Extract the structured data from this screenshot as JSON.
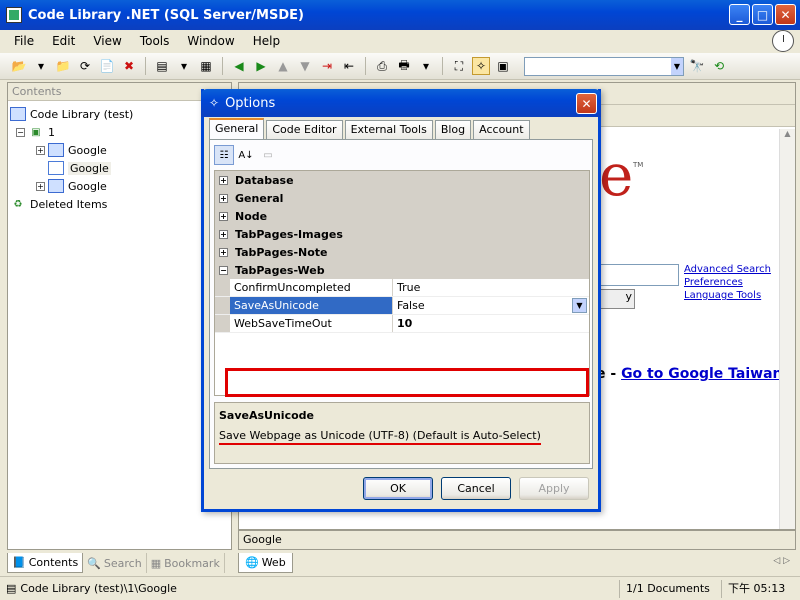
{
  "window": {
    "title": "Code Library .NET (SQL Server/MSDE)",
    "minimize": "_",
    "maximize": "□",
    "close": "✕"
  },
  "menu": [
    "File",
    "Edit",
    "View",
    "Tools",
    "Window",
    "Help"
  ],
  "left_panel": {
    "header": "Contents",
    "tree": {
      "root": "Code Library (test)",
      "node_1": "1",
      "child_a": "Google",
      "child_b": "Google",
      "child_c": "Google",
      "deleted": "Deleted Items"
    },
    "tabs": [
      "Contents",
      "Search",
      "Bookmark"
    ]
  },
  "right_panel": {
    "google_fragment": "e",
    "trademark": "TM",
    "button_fragment": "y",
    "links": [
      "Advanced Search",
      "Preferences",
      "Language Tools"
    ],
    "taiwan_prefix": "e - ",
    "taiwan_link": "Go to Google Taiwan",
    "footer_label": "Google",
    "tab_label": "Web"
  },
  "status_bar": {
    "path": "Code Library (test)\\1\\Google",
    "documents": "1/1 Documents",
    "time": "下午 05:13"
  },
  "dialog": {
    "title": "Options",
    "close": "✕",
    "tabs": [
      "General",
      "Code Editor",
      "External Tools",
      "Blog",
      "Account"
    ],
    "categories": [
      "Database",
      "General",
      "Node",
      "TabPages-Images",
      "TabPages-Note",
      "TabPages-Web"
    ],
    "properties": [
      {
        "name": "ConfirmUncompleted",
        "value": "True"
      },
      {
        "name": "SaveAsUnicode",
        "value": "False"
      },
      {
        "name": "WebSaveTimeOut",
        "value": "10"
      }
    ],
    "description_title": "SaveAsUnicode",
    "description_text": "Save Webpage as Unicode (UTF-8) (Default is Auto-Select)",
    "buttons": {
      "ok": "OK",
      "cancel": "Cancel",
      "apply": "Apply"
    }
  },
  "colors": {
    "title_blue": "#0046d5",
    "selection_blue": "#316ac5",
    "highlight_red": "#e00000",
    "google_red": "#c0211b",
    "link_blue": "#0000cc"
  }
}
